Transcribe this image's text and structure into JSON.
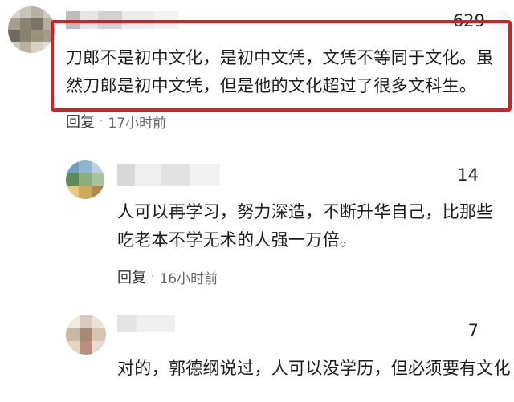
{
  "comments": [
    {
      "likes": "629",
      "text": "刀郎不是初中文化，是初中文凭，文凭不等同于文化。虽然刀郎是初中文凭，但是他的文化超过了很多文科生。",
      "reply_label": "回复",
      "separator": "·",
      "time": "17小时前"
    },
    {
      "likes": "14",
      "text": "人可以再学习，努力深造，不断升华自己，比那些吃老本不学无术的人强一万倍。",
      "reply_label": "回复",
      "separator": "·",
      "time": "16小时前"
    },
    {
      "likes": "7",
      "text": "对的，郭德纲说过，人可以没学历，但必须要有文化"
    }
  ],
  "colors": {
    "highlight_border": "#d81e1e",
    "text": "#1c1c1c",
    "meta": "#666666"
  }
}
